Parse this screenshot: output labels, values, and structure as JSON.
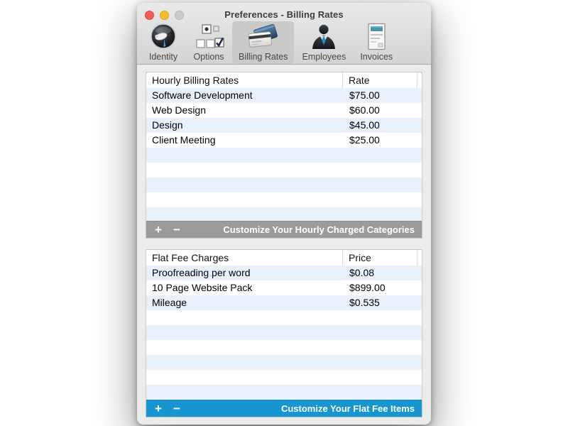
{
  "window": {
    "title": "Preferences - Billing Rates",
    "toolbar": {
      "items": [
        {
          "label": "Identity",
          "selected": false
        },
        {
          "label": "Options",
          "selected": false
        },
        {
          "label": "Billing Rates",
          "selected": true
        },
        {
          "label": "Employees",
          "selected": false
        },
        {
          "label": "Invoices",
          "selected": false
        }
      ]
    }
  },
  "hourly_table": {
    "header": {
      "name_col": "Hourly Billing Rates",
      "value_col": "Rate"
    },
    "rows": [
      {
        "name": "Software Development",
        "value": "$75.00"
      },
      {
        "name": "Web Design",
        "value": "$60.00"
      },
      {
        "name": "Design",
        "value": "$45.00"
      },
      {
        "name": "Client Meeting",
        "value": "$25.00"
      }
    ],
    "footer": {
      "add": "+",
      "remove": "−",
      "caption": "Customize Your Hourly Charged Categories"
    }
  },
  "flat_fee_table": {
    "header": {
      "name_col": "Flat Fee Charges",
      "value_col": "Price"
    },
    "rows": [
      {
        "name": "Proofreading per word",
        "value": "$0.08"
      },
      {
        "name": "10 Page Website Pack",
        "value": "$899.00"
      },
      {
        "name": "Mileage",
        "value": "$0.535"
      }
    ],
    "footer": {
      "add": "+",
      "remove": "−",
      "caption": "Customize Your Flat Fee Items"
    }
  },
  "colors": {
    "accent_blue_footer": "#1795d0",
    "gray_footer": "#9b9b9b",
    "row_stripe_blue": "#e9f1fb",
    "toolbar_selected": "#cbcacb"
  }
}
